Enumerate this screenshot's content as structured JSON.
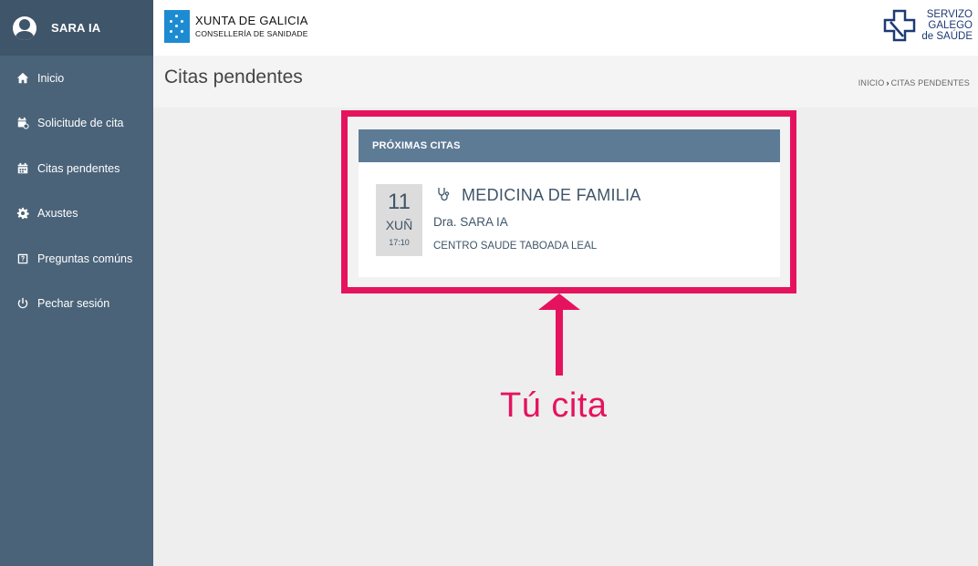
{
  "sidebar": {
    "user_name": "SARA IA",
    "items": [
      {
        "label": "Inicio",
        "icon": "home-icon"
      },
      {
        "label": "Solicitude de cita",
        "icon": "calendar-clock-icon"
      },
      {
        "label": "Citas pendentes",
        "icon": "calendar-icon"
      },
      {
        "label": "Axustes",
        "icon": "gear-icon"
      },
      {
        "label": "Preguntas comúns",
        "icon": "question-icon"
      },
      {
        "label": "Pechar sesión",
        "icon": "power-icon"
      }
    ]
  },
  "header": {
    "xunta_title": "XUNTA DE GALICIA",
    "xunta_subtitle": "CONSELLERÍA DE SANIDADE",
    "sergas_line1": "SERVIZO",
    "sergas_line2": "GALEGO",
    "sergas_line3": "de SAÚDE"
  },
  "page": {
    "title": "Citas pendentes",
    "breadcrumb_home": "INICIO",
    "breadcrumb_current": "CITAS PENDENTES"
  },
  "appointments": {
    "header": "PRÓXIMAS CITAS",
    "item": {
      "day": "11",
      "month": "XUÑ",
      "time": "17:10",
      "specialty": "MEDICINA DE FAMILIA",
      "doctor": "Dra. SARA IA",
      "center": "CENTRO SAUDE TABOADA LEAL"
    }
  },
  "annotation": {
    "text": "Tú cita",
    "color": "#e5135e"
  },
  "colors": {
    "sidebar": "#4a6379",
    "card_header": "#5e7b96",
    "accent": "#e5135e"
  }
}
